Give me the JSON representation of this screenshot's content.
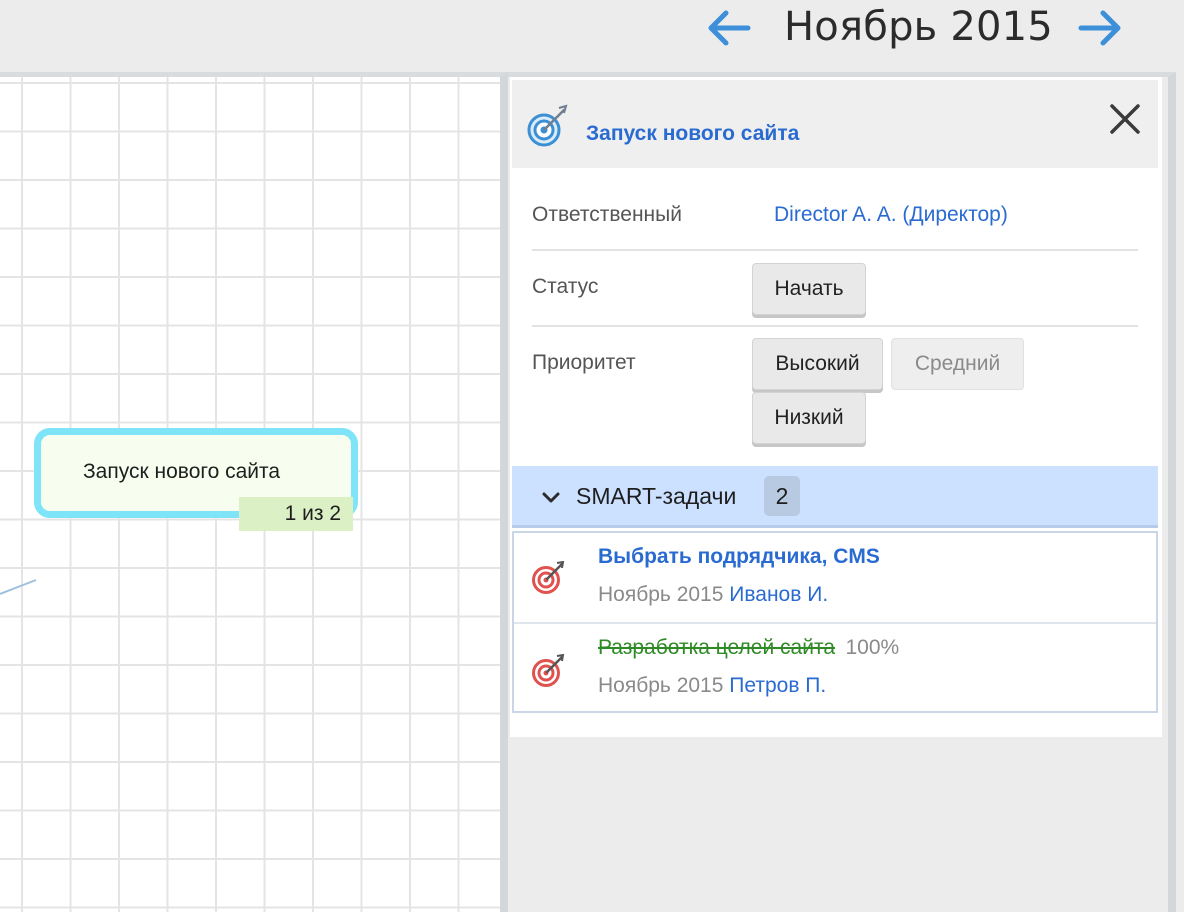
{
  "nav": {
    "month": "Ноябрь 2015",
    "prev_icon": "arrow-left-icon",
    "next_icon": "arrow-right-icon",
    "arrow_color": "#3c8fd8"
  },
  "canvas": {
    "node": {
      "label": "Запуск нового сайта",
      "counter": "1 из 2",
      "border_color": "#7fe4f7"
    }
  },
  "panel": {
    "icon": "target-icon",
    "title": "Запуск нового сайта",
    "close_icon": "close-icon",
    "fields": {
      "responsible_label": "Ответственный",
      "responsible_value": "Director A. A. (Директор)",
      "status_label": "Статус",
      "status_button": "Начать",
      "priority_label": "Приоритет",
      "priority_options": [
        "Высокий",
        "Средний",
        "Низкий"
      ],
      "priority_selected": "Средний"
    },
    "smart": {
      "label": "SMART-задачи",
      "count": "2",
      "chevron_icon": "chevron-down-icon"
    },
    "tasks": [
      {
        "title": "Выбрать подрядчика, CMS",
        "done": false,
        "month": "Ноябрь 2015",
        "owner": "Иванов И.",
        "icon": "target-icon"
      },
      {
        "title": "Разработка целей сайта",
        "done": true,
        "percent": "100%",
        "month": "Ноябрь 2015",
        "owner": "Петров П.",
        "icon": "target-icon"
      }
    ]
  },
  "colors": {
    "link": "#2a6bd1",
    "done": "#2e8a25",
    "smart_bar": "#cce0ff"
  }
}
